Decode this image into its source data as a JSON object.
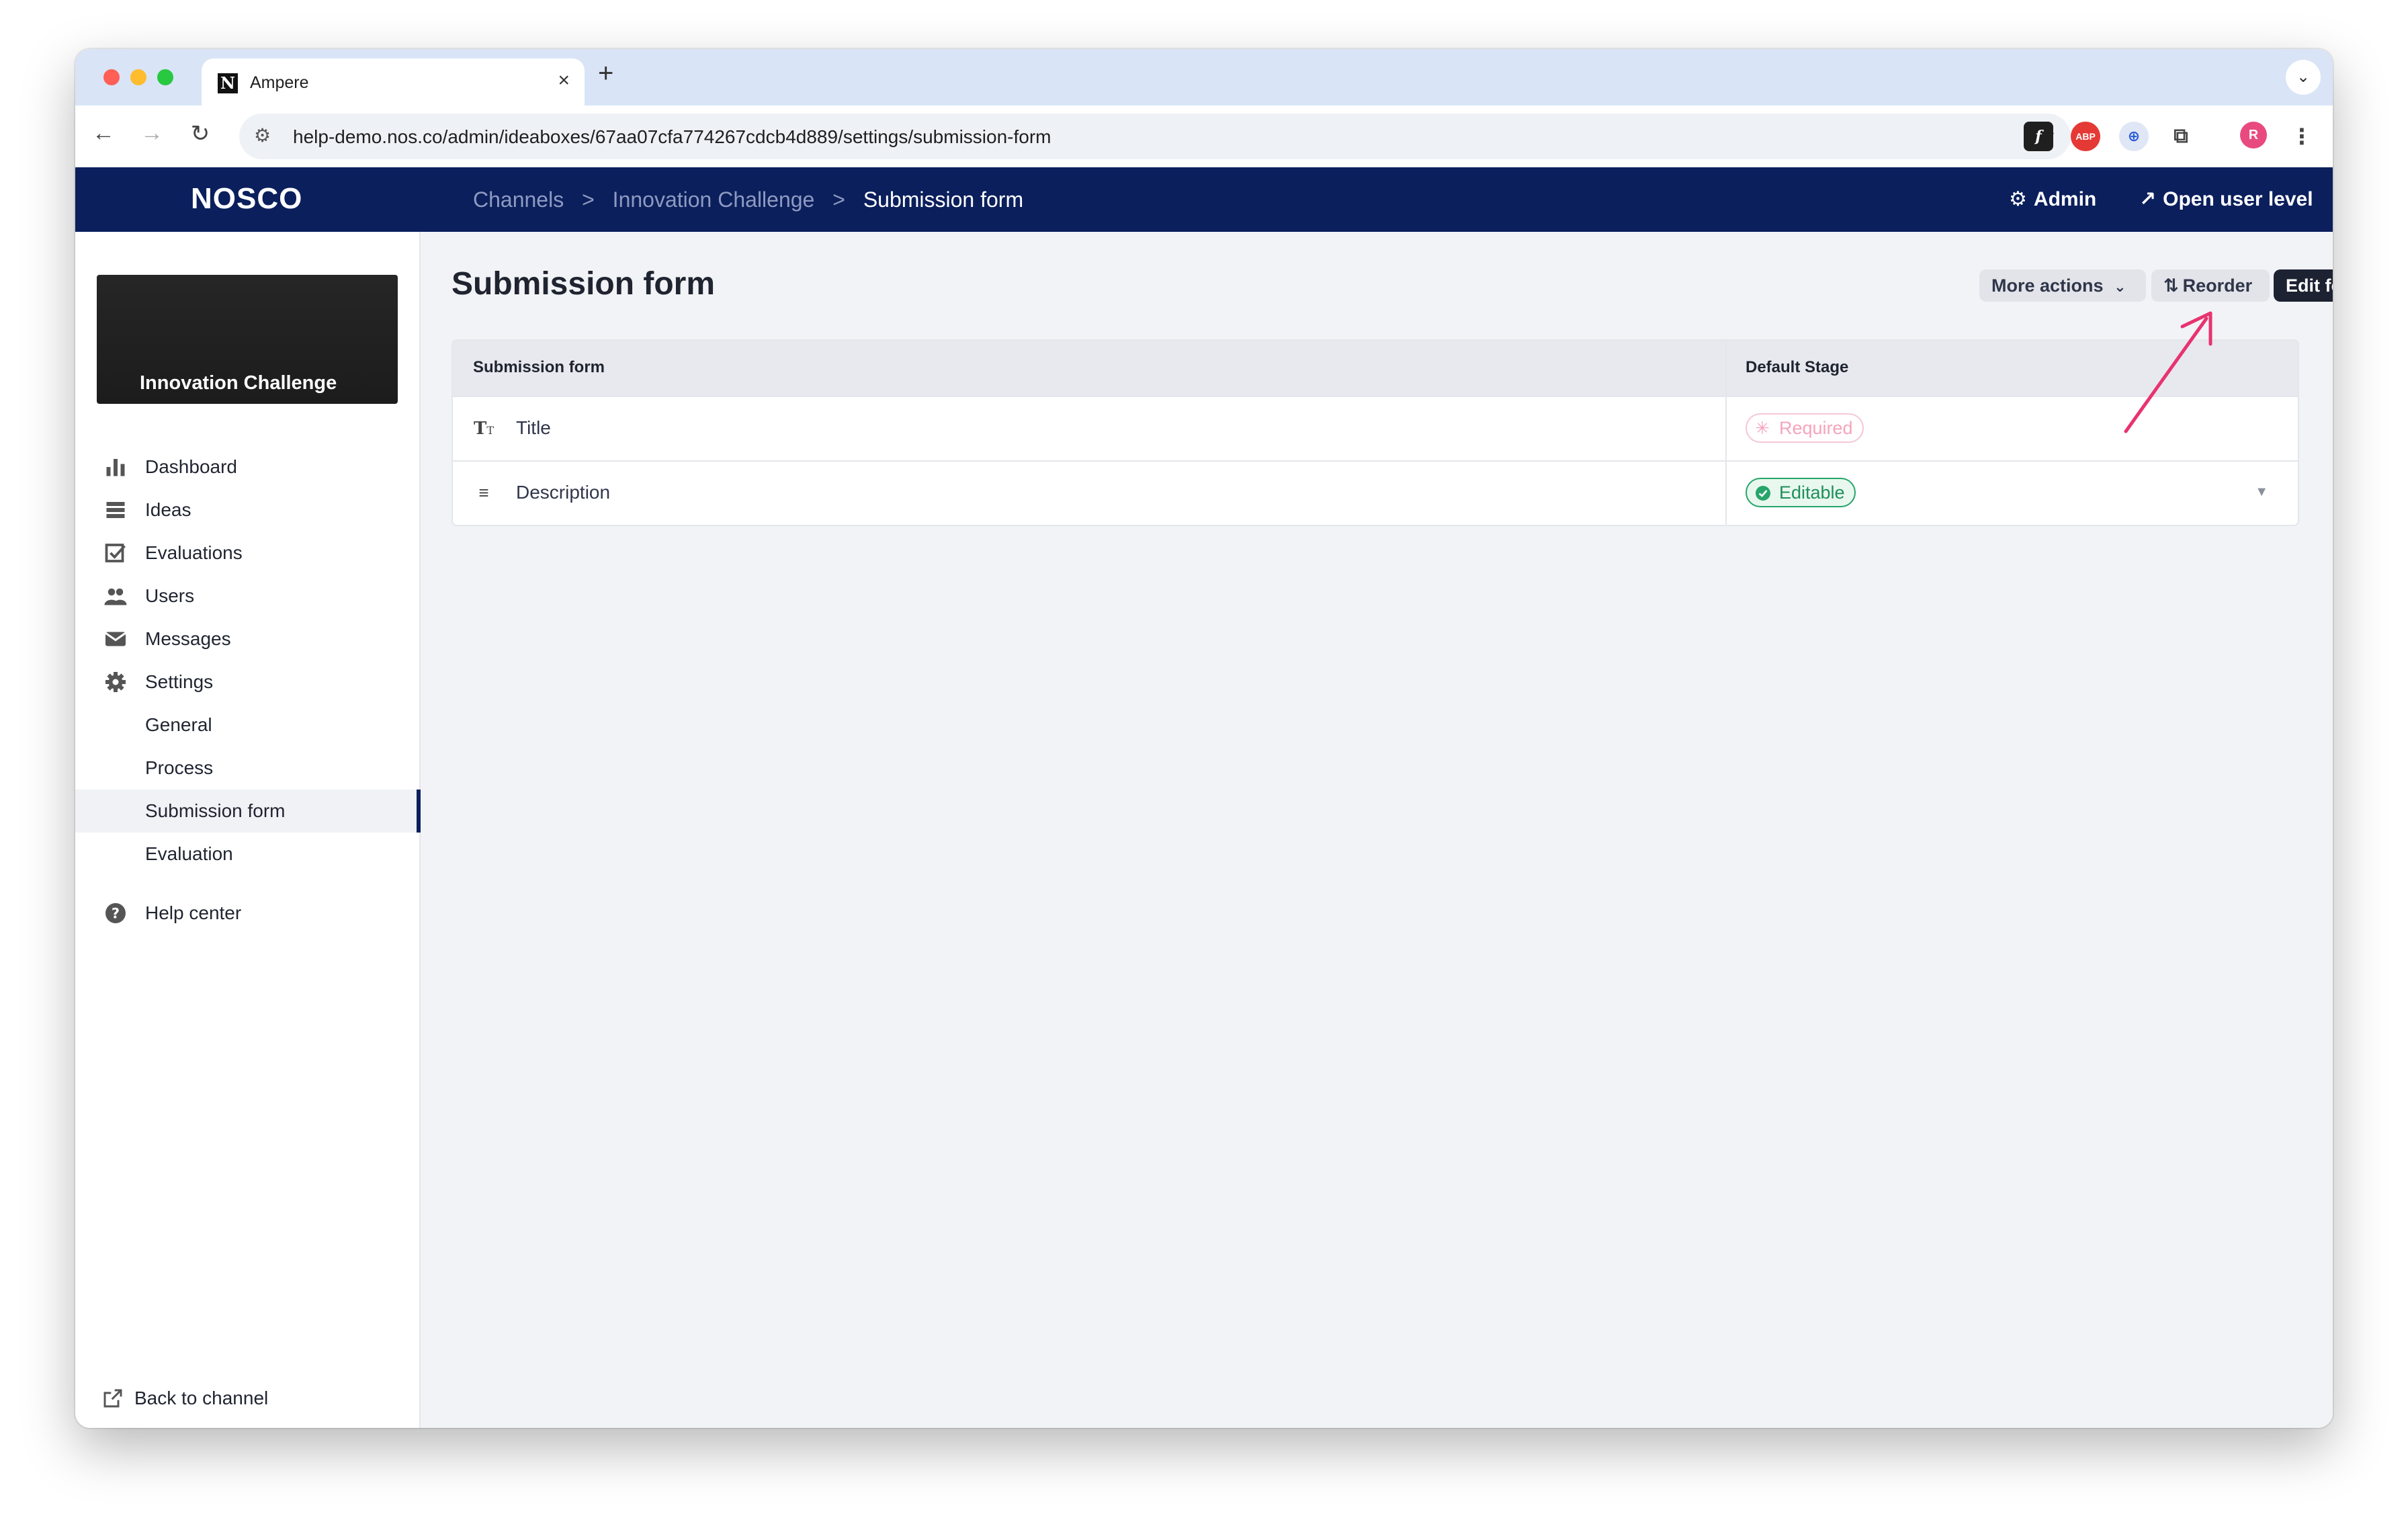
{
  "browser": {
    "tab_title": "Ampere",
    "tab_favicon": "N",
    "url": "help-demo.nos.co/admin/ideaboxes/67aa07cfa774267cdcb4d889/settings/submission-form",
    "profile_initial": "R",
    "ext_abp": "ABP"
  },
  "header": {
    "logo": "NOSCO",
    "breadcrumbs": [
      "Channels",
      "Innovation Challenge",
      "Submission form"
    ],
    "crumb_sep": ">",
    "admin_label": "Admin",
    "open_user_label": "Open user level"
  },
  "sidebar": {
    "channel_title": "Innovation Challenge",
    "items": [
      {
        "label": "Dashboard",
        "icon": "bar-chart-icon"
      },
      {
        "label": "Ideas",
        "icon": "list-icon"
      },
      {
        "label": "Evaluations",
        "icon": "checkbox-icon"
      },
      {
        "label": "Users",
        "icon": "users-icon"
      },
      {
        "label": "Messages",
        "icon": "envelope-icon"
      },
      {
        "label": "Settings",
        "icon": "gear-icon"
      }
    ],
    "sub_items": [
      "General",
      "Process",
      "Submission form",
      "Evaluation"
    ],
    "active_sub": "Submission form",
    "help_label": "Help center",
    "back_label": "Back to channel"
  },
  "main": {
    "title": "Submission form",
    "more_actions_label": "More actions",
    "reorder_label": "Reorder",
    "edit_label": "Edit form",
    "table": {
      "col1": "Submission form",
      "col2": "Default Stage",
      "rows": [
        {
          "field": "Title",
          "icon": "text-type-icon",
          "stage": "Required"
        },
        {
          "field": "Description",
          "icon": "paragraph-icon",
          "stage": "Editable"
        }
      ]
    }
  },
  "colors": {
    "header_bg": "#0b1f5c",
    "required": "#f5a4bd",
    "editable": "#27a56a",
    "annotation_arrow": "#e8336f"
  }
}
